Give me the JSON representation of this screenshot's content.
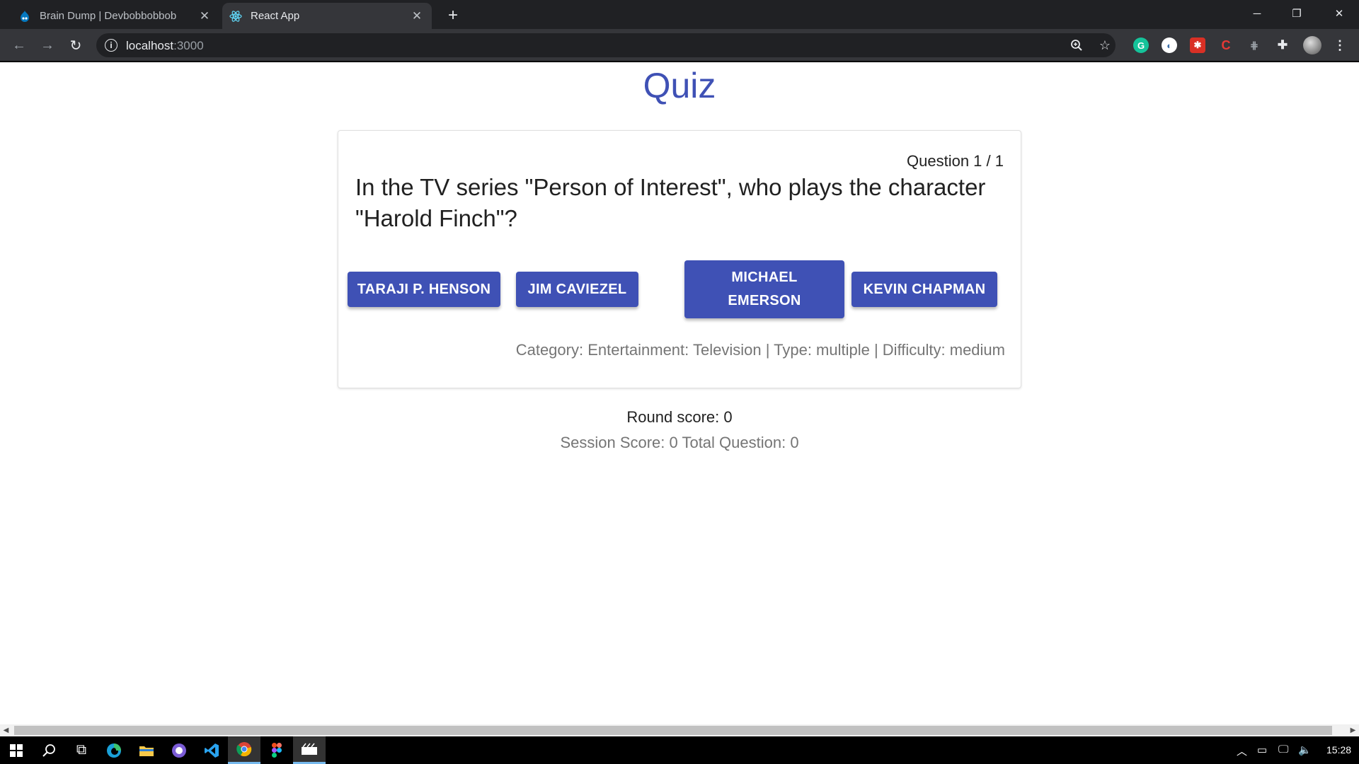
{
  "browser": {
    "tabs": [
      {
        "title": "Brain Dump | Devbobbobbob",
        "active": false
      },
      {
        "title": "React App",
        "active": true
      }
    ],
    "address": {
      "host": "localhost",
      "port": ":3000"
    }
  },
  "quiz": {
    "title": "Quiz",
    "question_counter": "Question 1 / 1",
    "question": "In the TV series \"Person of Interest\", who plays the character \"Harold Finch\"?",
    "answers": [
      "TARAJI P. HENSON",
      "JIM CAVIEZEL",
      "MICHAEL EMERSON",
      "KEVIN CHAPMAN"
    ],
    "meta": "Category: Entertainment: Television | Type: multiple | Difficulty: medium",
    "round_score": "Round score: 0",
    "session_score": "Session Score: 0 Total Question: 0"
  },
  "taskbar": {
    "clock": "15:28"
  },
  "colors": {
    "primary": "#3f51b5",
    "chrome_dark": "#202124",
    "chrome_toolbar": "#35363a"
  }
}
